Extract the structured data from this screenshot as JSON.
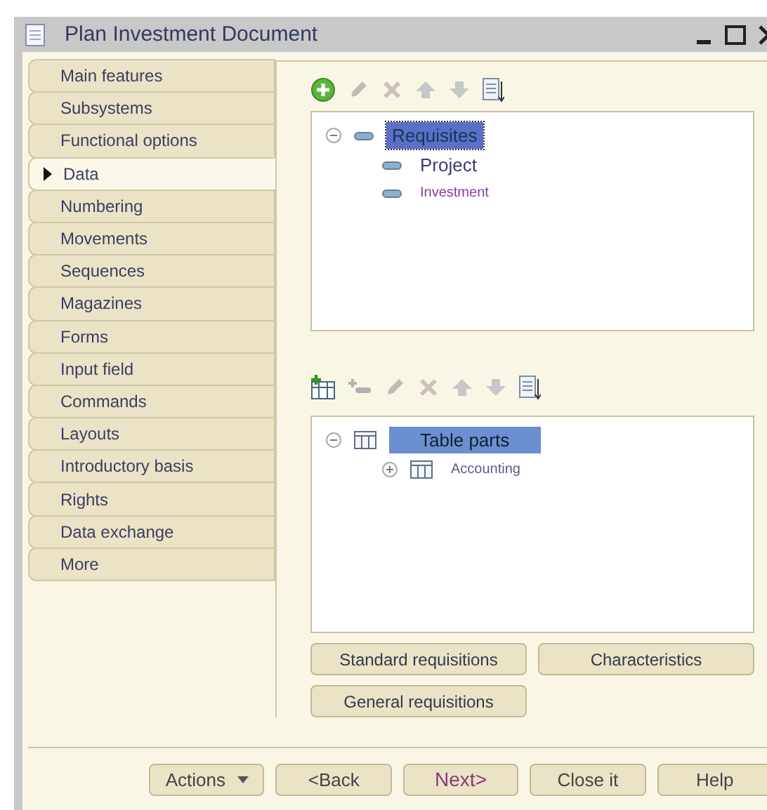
{
  "window": {
    "title": "Plan Investment Document"
  },
  "tabs": [
    {
      "label": "Main features",
      "selected": false
    },
    {
      "label": "Subsystems",
      "selected": false
    },
    {
      "label": "Functional options",
      "selected": false
    },
    {
      "label": "Data",
      "selected": true
    },
    {
      "label": "Numbering",
      "selected": false
    },
    {
      "label": "Movements",
      "selected": false
    },
    {
      "label": "Sequences",
      "selected": false
    },
    {
      "label": "Magazines",
      "selected": false
    },
    {
      "label": "Forms",
      "selected": false
    },
    {
      "label": "Input field",
      "selected": false
    },
    {
      "label": "Commands",
      "selected": false
    },
    {
      "label": "Layouts",
      "selected": false
    },
    {
      "label": "Introductory basis",
      "selected": false
    },
    {
      "label": "Rights",
      "selected": false
    },
    {
      "label": "Data exchange",
      "selected": false
    },
    {
      "label": "More",
      "selected": false
    }
  ],
  "requisites_toolbar": [
    {
      "kind": "add",
      "disabled": false
    },
    {
      "kind": "edit",
      "disabled": true
    },
    {
      "kind": "delete",
      "disabled": true
    },
    {
      "kind": "up",
      "disabled": true
    },
    {
      "kind": "down",
      "disabled": true
    },
    {
      "kind": "sort",
      "disabled": false
    }
  ],
  "requisites_tree": [
    {
      "label": "Requisites",
      "kind": "attribute",
      "expanded": true,
      "selected": true,
      "children": [
        {
          "label": "Project",
          "kind": "attribute",
          "selected": false
        },
        {
          "label": "Investment",
          "kind": "attribute",
          "selected": false
        }
      ]
    }
  ],
  "table_parts_toolbar": [
    {
      "kind": "add-table",
      "disabled": false
    },
    {
      "kind": "add-attribute",
      "disabled": true
    },
    {
      "kind": "edit",
      "disabled": true
    },
    {
      "kind": "delete",
      "disabled": true
    },
    {
      "kind": "up",
      "disabled": true
    },
    {
      "kind": "down",
      "disabled": true
    },
    {
      "kind": "sort",
      "disabled": false
    }
  ],
  "table_parts_tree": [
    {
      "label": "Table parts",
      "kind": "table",
      "expanded": true,
      "selected": true,
      "children": [
        {
          "label": "Accounting",
          "kind": "table",
          "expanded": false,
          "selected": false
        }
      ]
    }
  ],
  "section_buttons": [
    "Standard requisitions",
    "Characteristics",
    "General requisitions"
  ],
  "footer_buttons": [
    {
      "label": "Actions",
      "kind": "menu"
    },
    {
      "label": "<Back",
      "kind": "plain"
    },
    {
      "label": "Next>",
      "kind": "default"
    },
    {
      "label": "Close it",
      "kind": "plain"
    },
    {
      "label": "Help",
      "kind": "plain"
    }
  ]
}
